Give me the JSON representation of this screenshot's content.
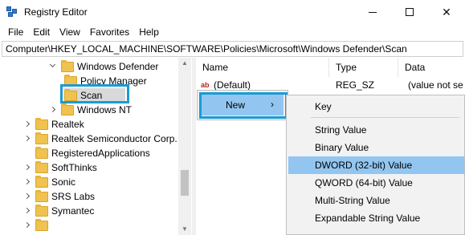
{
  "window": {
    "title": "Registry Editor",
    "min_glyph": "",
    "max_glyph": "",
    "close_glyph": "✕"
  },
  "menubar": [
    "File",
    "Edit",
    "View",
    "Favorites",
    "Help"
  ],
  "address": "Computer\\HKEY_LOCAL_MACHINE\\SOFTWARE\\Policies\\Microsoft\\Windows Defender\\Scan",
  "tree": {
    "items": [
      {
        "label": "Windows Defender",
        "expander": "down",
        "folder": true
      },
      {
        "label": "Policy Manager",
        "expander": "",
        "folder": true
      },
      {
        "label": "Scan",
        "expander": "",
        "folder": true,
        "selected": true
      },
      {
        "label": "Windows NT",
        "expander": "right",
        "folder": true
      },
      {
        "label": "Realtek",
        "expander": "right",
        "folder": true
      },
      {
        "label": "Realtek Semiconductor Corp.",
        "expander": "right",
        "folder": true
      },
      {
        "label": "RegisteredApplications",
        "expander": "",
        "folder": true
      },
      {
        "label": "SoftThinks",
        "expander": "right",
        "folder": true
      },
      {
        "label": "Sonic",
        "expander": "right",
        "folder": true
      },
      {
        "label": "SRS Labs",
        "expander": "right",
        "folder": true
      },
      {
        "label": "Symantec",
        "expander": "right",
        "folder": true
      }
    ]
  },
  "values": {
    "columns": {
      "name": "Name",
      "type": "Type",
      "data": "Data"
    },
    "rows": [
      {
        "icon": "ab",
        "name": "(Default)",
        "type": "REG_SZ",
        "data": "(value not se"
      }
    ]
  },
  "context_menu": {
    "new_label": "New",
    "new_arrow": "›"
  },
  "submenu": {
    "items": [
      {
        "label": "Key",
        "active": false
      },
      {
        "label": "String Value",
        "active": false
      },
      {
        "label": "Binary Value",
        "active": false
      },
      {
        "label": "DWORD (32-bit) Value",
        "active": true
      },
      {
        "label": "QWORD (64-bit) Value",
        "active": false
      },
      {
        "label": "Multi-String Value",
        "active": false
      },
      {
        "label": "Expandable String Value",
        "active": false
      }
    ]
  },
  "colors": {
    "highlight_border": "#1a9bd5",
    "menu_hover": "#92c6f0",
    "folder": "#f0c24f"
  }
}
